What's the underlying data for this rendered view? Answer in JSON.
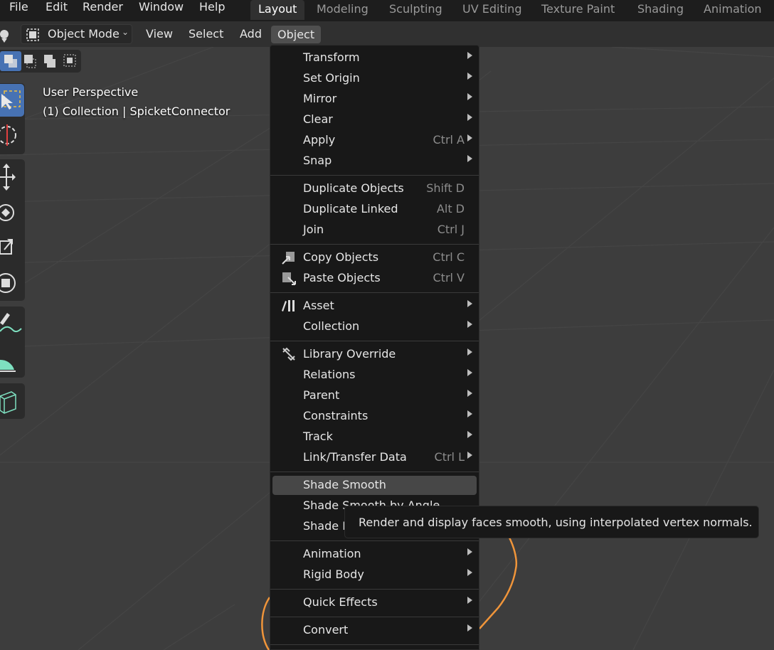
{
  "app_menu": [
    "File",
    "Edit",
    "Render",
    "Window",
    "Help"
  ],
  "workspace_tabs": [
    "Layout",
    "Modeling",
    "Sculpting",
    "UV Editing",
    "Texture Paint",
    "Shading",
    "Animation"
  ],
  "active_workspace": "Layout",
  "header": {
    "mode": "Object Mode",
    "menus": [
      "View",
      "Select",
      "Add",
      "Object"
    ],
    "open_menu": "Object"
  },
  "viewport": {
    "perspective": "User Perspective",
    "collection_info": "(1) Collection | SpicketConnector"
  },
  "object_menu": {
    "items": [
      {
        "label": "Transform",
        "shortcut": "",
        "submenu": true,
        "icon": ""
      },
      {
        "label": "Set Origin",
        "shortcut": "",
        "submenu": true,
        "icon": ""
      },
      {
        "label": "Mirror",
        "shortcut": "",
        "submenu": true,
        "icon": ""
      },
      {
        "label": "Clear",
        "shortcut": "",
        "submenu": true,
        "icon": ""
      },
      {
        "label": "Apply",
        "shortcut": "Ctrl A",
        "submenu": true,
        "icon": ""
      },
      {
        "label": "Snap",
        "shortcut": "",
        "submenu": true,
        "icon": ""
      },
      {
        "label": "Duplicate Objects",
        "shortcut": "Shift D",
        "submenu": false,
        "icon": ""
      },
      {
        "label": "Duplicate Linked",
        "shortcut": "Alt D",
        "submenu": false,
        "icon": ""
      },
      {
        "label": "Join",
        "shortcut": "Ctrl J",
        "submenu": false,
        "icon": ""
      },
      {
        "label": "Copy Objects",
        "shortcut": "Ctrl C",
        "submenu": false,
        "icon": "copy-objects-icon"
      },
      {
        "label": "Paste Objects",
        "shortcut": "Ctrl V",
        "submenu": false,
        "icon": "paste-objects-icon"
      },
      {
        "label": "Asset",
        "shortcut": "",
        "submenu": true,
        "icon": "asset-icon"
      },
      {
        "label": "Collection",
        "shortcut": "",
        "submenu": true,
        "icon": ""
      },
      {
        "label": "Library Override",
        "shortcut": "",
        "submenu": true,
        "icon": "library-override-icon"
      },
      {
        "label": "Relations",
        "shortcut": "",
        "submenu": true,
        "icon": ""
      },
      {
        "label": "Parent",
        "shortcut": "",
        "submenu": true,
        "icon": ""
      },
      {
        "label": "Constraints",
        "shortcut": "",
        "submenu": true,
        "icon": ""
      },
      {
        "label": "Track",
        "shortcut": "",
        "submenu": true,
        "icon": ""
      },
      {
        "label": "Link/Transfer Data",
        "shortcut": "Ctrl L",
        "submenu": true,
        "icon": ""
      },
      {
        "label": "Shade Smooth",
        "shortcut": "",
        "submenu": false,
        "icon": "",
        "highlighted": true
      },
      {
        "label": "Shade Smooth by Angle",
        "shortcut": "",
        "submenu": false,
        "icon": ""
      },
      {
        "label": "Shade Flat",
        "shortcut": "",
        "submenu": false,
        "icon": ""
      },
      {
        "label": "Animation",
        "shortcut": "",
        "submenu": true,
        "icon": ""
      },
      {
        "label": "Rigid Body",
        "shortcut": "",
        "submenu": true,
        "icon": ""
      },
      {
        "label": "Quick Effects",
        "shortcut": "",
        "submenu": true,
        "icon": ""
      },
      {
        "label": "Convert",
        "shortcut": "",
        "submenu": true,
        "icon": ""
      }
    ]
  },
  "tooltip": "Render and display faces smooth, using interpolated vertex normals.",
  "colors": {
    "accent": "#4772b3",
    "selection_outline": "#f0953a",
    "menu_bg": "#181818",
    "viewport_bg": "#3d3d3d"
  }
}
